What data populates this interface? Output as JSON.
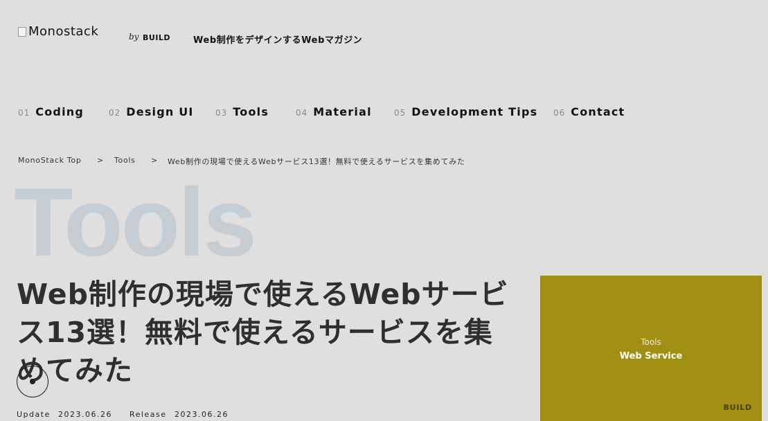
{
  "header": {
    "logo_text": "Monostack",
    "by": "by",
    "build": "BUILD",
    "tagline": "Web制作をデザインするWebマガジン"
  },
  "nav": {
    "items": [
      {
        "num": "01",
        "label": "Coding"
      },
      {
        "num": "02",
        "label": "Design UI"
      },
      {
        "num": "03",
        "label": "Tools"
      },
      {
        "num": "04",
        "label": "Material"
      },
      {
        "num": "05",
        "label": "Development Tips"
      },
      {
        "num": "06",
        "label": "Contact"
      }
    ]
  },
  "breadcrumb": {
    "home": "MonoStack Top",
    "sep": ">",
    "category": "Tools",
    "current": "Web制作の現場で使えるWebサービス13選！無料で使えるサービスを集めてみた"
  },
  "category_big": "Tools",
  "article": {
    "title": "Web制作の現場で使えるWebサービス13選！無料で使えるサービスを集めてみた",
    "update_label": "Update",
    "update_date": "2023.06.26",
    "release_label": "Release",
    "release_date": "2023.06.26"
  },
  "thumbnail": {
    "category": "Tools",
    "subtitle": "Web Service",
    "brand": "BUILD",
    "background": "#a08f12"
  }
}
